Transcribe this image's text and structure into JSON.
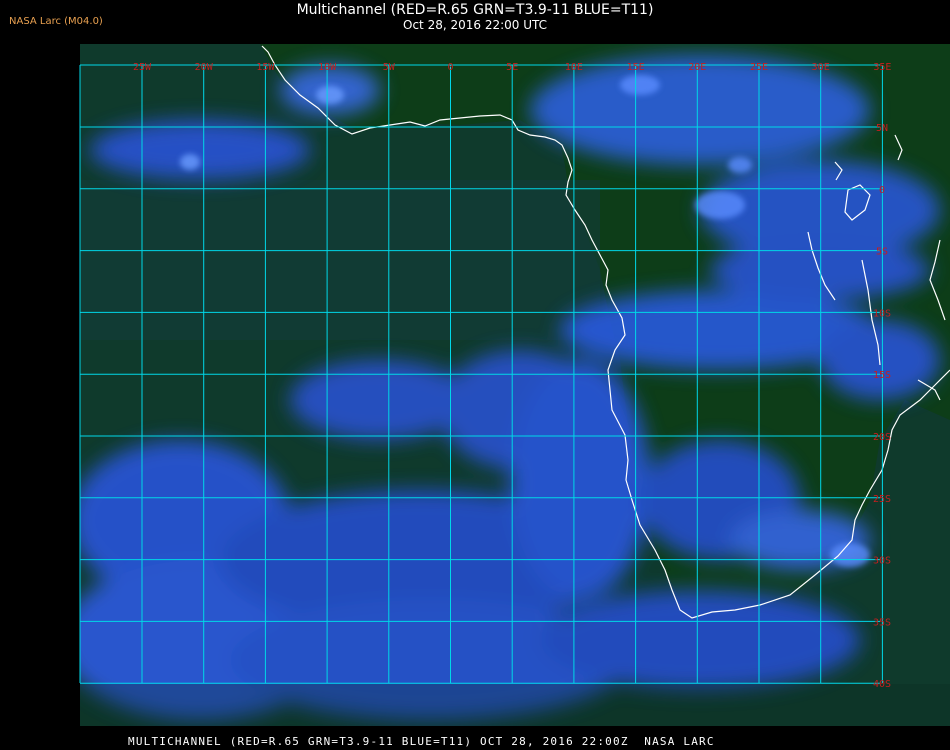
{
  "header": {
    "title": "Multichannel (RED=R.65 GRN=T3.9-11 BLUE=T11)",
    "subtitle": "Oct 28, 2016 22:00 UTC",
    "credit": "NASA Larc (M04.0)"
  },
  "footer": {
    "text": "MULTICHANNEL (RED=R.65 GRN=T3.9-11 BLUE=T11) OCT 28, 2016 22:00Z  NASA LARC"
  },
  "grid": {
    "longitudes": [
      "25W",
      "20W",
      "15W",
      "10W",
      "5W",
      "0",
      "5E",
      "10E",
      "15E",
      "20E",
      "25E",
      "30E",
      "35E"
    ],
    "latitudes": [
      "5N",
      "0",
      "5S",
      "10S",
      "15S",
      "20S",
      "25S",
      "30S",
      "35S",
      "40S"
    ]
  },
  "colors": {
    "grid": "#00d8e8",
    "label": "#c81e1e",
    "coast": "#ffffff",
    "land": "#0e3d1a",
    "ocean": "#103a30",
    "cloud": "#2a5cff"
  }
}
